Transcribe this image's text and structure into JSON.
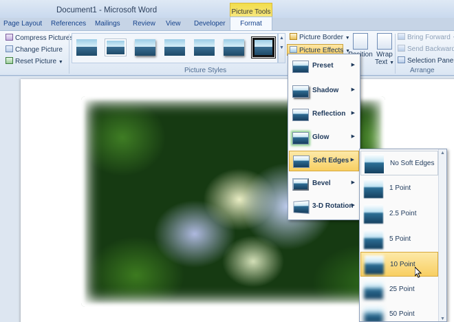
{
  "titlebar": {
    "document_title": "Document1 - Microsoft Word",
    "context_tab": "Picture Tools"
  },
  "tabs": {
    "page_layout": "Page Layout",
    "references": "References",
    "mailings": "Mailings",
    "review": "Review",
    "view": "View",
    "developer": "Developer",
    "format": "Format"
  },
  "ribbon": {
    "adjust": {
      "compress": "Compress Pictures",
      "change": "Change Picture",
      "reset": "Reset Picture"
    },
    "picture_styles": {
      "label": "Picture Styles",
      "picture_border": "Picture Border",
      "picture_effects": "Picture Effects"
    },
    "position": "Position",
    "wrap_text_1": "Wrap",
    "wrap_text_2": "Text",
    "arrange": {
      "label": "Arrange",
      "bring_forward": "Bring Forward",
      "send_backward": "Send Backward",
      "selection_pane": "Selection Pane"
    }
  },
  "effects_menu": {
    "items": [
      "Preset",
      "Shadow",
      "Reflection",
      "Glow",
      "Soft Edges",
      "Bevel",
      "3-D Rotation"
    ],
    "active": "Soft Edges"
  },
  "soft_edges_menu": {
    "items": [
      "No Soft Edges",
      "1 Point",
      "2.5 Point",
      "5 Point",
      "10 Point",
      "25 Point",
      "50 Point"
    ],
    "hovered": "10 Point"
  }
}
